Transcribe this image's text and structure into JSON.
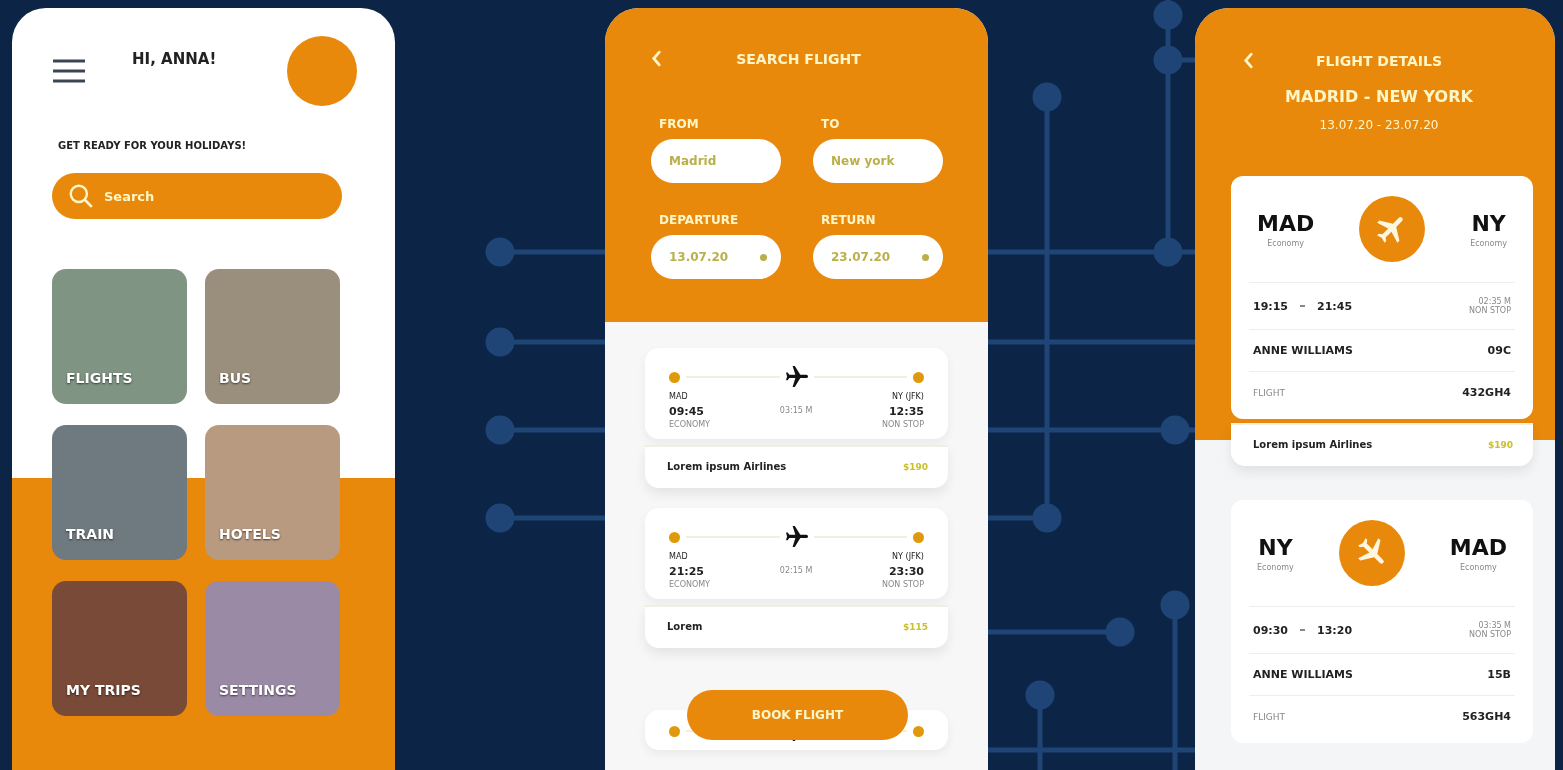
{
  "home": {
    "greeting": "HI, ANNA!",
    "tagline": "GET READY FOR YOUR HOLIDAYS!",
    "search": {
      "placeholder": "Search"
    },
    "categories": [
      {
        "label": "FLIGHTS"
      },
      {
        "label": "BUS"
      },
      {
        "label": "TRAIN"
      },
      {
        "label": "HOTELS"
      },
      {
        "label": "MY TRIPS"
      },
      {
        "label": "SETTINGS"
      }
    ]
  },
  "search_flight": {
    "title": "SEARCH FLIGHT",
    "fields": [
      {
        "label": "FROM",
        "value": "Madrid",
        "kind": "text"
      },
      {
        "label": "TO",
        "value": "New york",
        "kind": "text"
      },
      {
        "label": "DEPARTURE",
        "value": "13.07.20",
        "kind": "date"
      },
      {
        "label": "RETURN",
        "value": "23.07.20",
        "kind": "date"
      }
    ],
    "results": [
      {
        "kind": "full",
        "from": "MAD",
        "to": "NY (JFK)",
        "depart": "09:45",
        "arrive": "12:35",
        "duration": "03:15 M",
        "from_note": "ECONOMY",
        "to_note": "NON STOP",
        "airline": "Lorem ipsum Airlines",
        "price": "$190"
      },
      {
        "kind": "full",
        "from": "MAD",
        "to": "NY (JFK)",
        "depart": "21:25",
        "arrive": "23:30",
        "duration": "02:15 M",
        "from_note": "ECONOMY",
        "to_note": "NON STOP",
        "airline": "Lorem",
        "price": "$115"
      },
      {
        "kind": "route-only"
      }
    ],
    "book_button": "BOOK FLIGHT"
  },
  "flight_details": {
    "title": "FLIGHT DETAILS",
    "route": "MADRID - NEW YORK",
    "dates": "13.07.20 - 23.07.20",
    "tickets": [
      {
        "kind": "takeoff",
        "from": "MAD",
        "from_class": "Economy",
        "to": "NY",
        "to_class": "Economy",
        "depart": "19:15",
        "arrive": "21:45",
        "duration": "02:35 M",
        "stops": "NON STOP",
        "passenger": "ANNE WILLIAMS",
        "seat": "09C",
        "flight_label": "FLIGHT",
        "flight": "432GH4",
        "airline": "Lorem ipsum Airlines",
        "price": "$190"
      },
      {
        "kind": "landing",
        "from": "NY",
        "from_class": "Economy",
        "to": "MAD",
        "to_class": "Economy",
        "depart": "09:30",
        "arrive": "13:20",
        "duration": "03:35 M",
        "stops": "NON STOP",
        "passenger": "ANNE WILLIAMS",
        "seat": "15B",
        "flight_label": "FLIGHT",
        "flight": "563GH4"
      }
    ]
  }
}
